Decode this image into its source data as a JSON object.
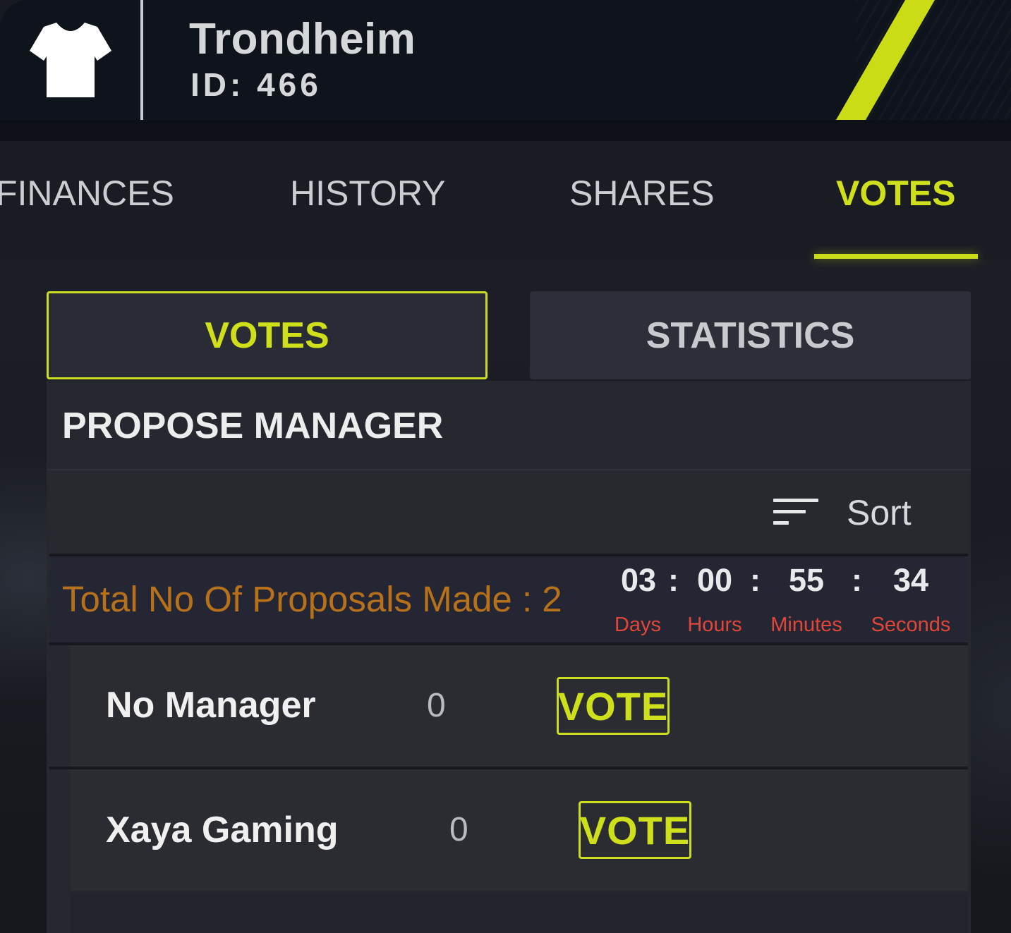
{
  "colors": {
    "accent": "#cfe01b",
    "background": "#171a20",
    "header": "#0f141c",
    "proposals_text": "#b7711a",
    "countdown_unit": "#e2453a"
  },
  "header": {
    "team_icon": "shirt-icon",
    "team_name": "Trondheim",
    "team_id": "ID: 466"
  },
  "tabs": [
    {
      "label": "FINANCES",
      "active": false
    },
    {
      "label": "HISTORY",
      "active": false
    },
    {
      "label": "SHARES",
      "active": false
    },
    {
      "label": "VOTES",
      "active": true
    }
  ],
  "subtabs": [
    {
      "label": "VOTES",
      "active": true
    },
    {
      "label": "STATISTICS",
      "active": false
    }
  ],
  "section": {
    "title": "PROPOSE MANAGER"
  },
  "sort": {
    "icon": "sort-icon",
    "label": "Sort"
  },
  "proposals": {
    "label": "Total No Of Proposals Made : 2"
  },
  "countdown": {
    "days": "03",
    "hours": "00",
    "minutes": "55",
    "seconds": "34",
    "separator": ":",
    "units": {
      "days": "Days",
      "hours": "Hours",
      "minutes": "Minutes",
      "seconds": "Seconds"
    }
  },
  "candidates": [
    {
      "name": "No Manager",
      "votes": "0",
      "button": "VOTE"
    },
    {
      "name": "Xaya Gaming",
      "votes": "0",
      "button": "VOTE"
    }
  ]
}
